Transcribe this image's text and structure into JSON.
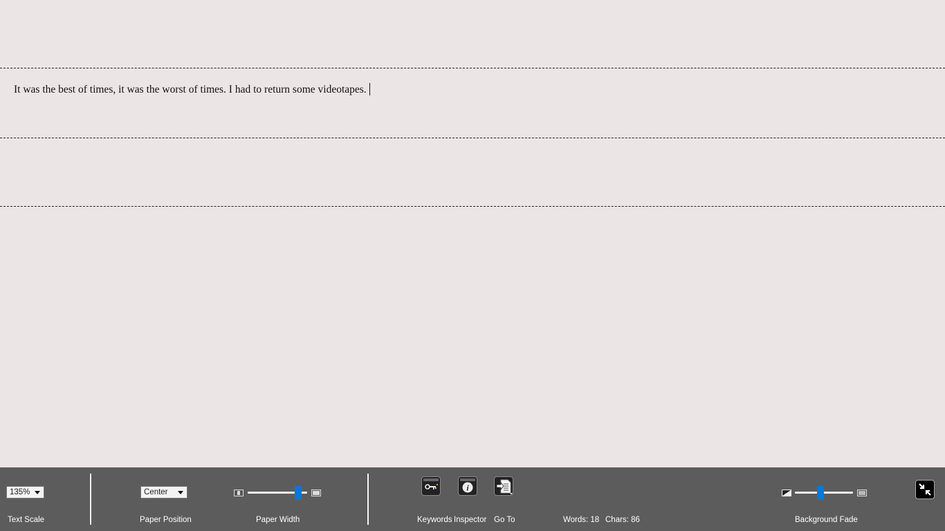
{
  "document": {
    "text": "It was the best of times, it was the worst of times. I had to return some videotapes."
  },
  "toolbar": {
    "text_scale": {
      "value": "135%",
      "label": "Text Scale"
    },
    "paper_position": {
      "value": "Center",
      "label": "Paper Position"
    },
    "paper_width": {
      "label": "Paper Width",
      "level": 0.9
    },
    "keywords": {
      "label": "Keywords",
      "icon": "key-icon"
    },
    "inspector": {
      "label": "Inspector",
      "icon": "info-icon"
    },
    "goto": {
      "label": "Go To",
      "icon": "goto-document-icon"
    },
    "stats": {
      "words": "Words: 18",
      "chars": "Chars: 86"
    },
    "background_fade": {
      "label": "Background Fade",
      "level": 0.43
    },
    "exit_fullscreen": {
      "icon": "exit-fullscreen-icon"
    }
  },
  "colors": {
    "editor_background": "#ebe6e5",
    "toolbar_background": "#5d5c5c",
    "slider_accent": "#0a78d7"
  }
}
